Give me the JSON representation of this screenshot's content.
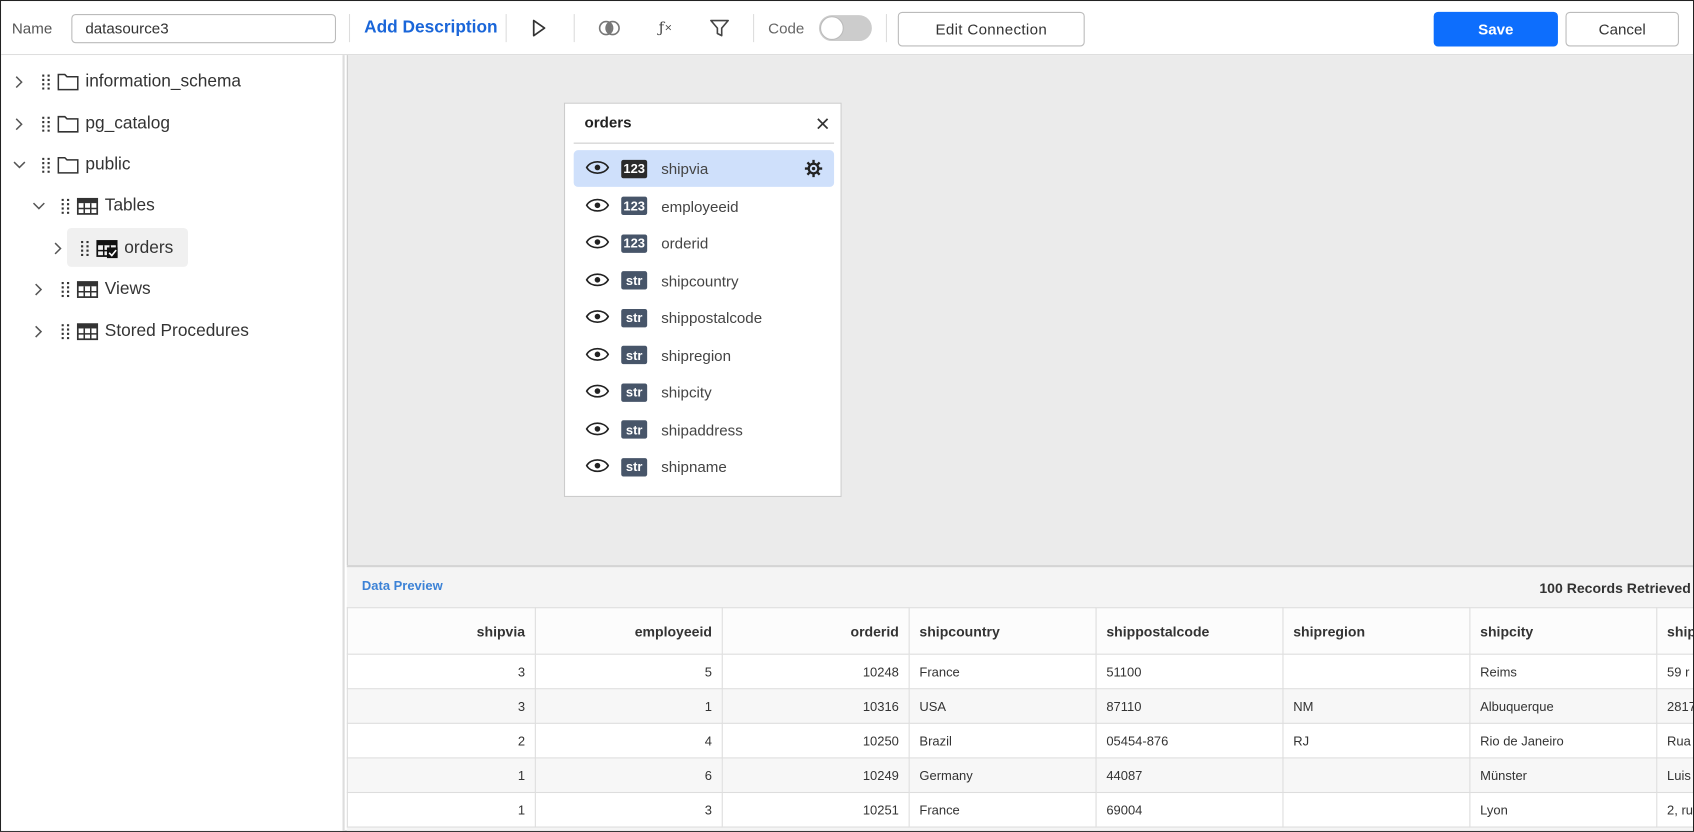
{
  "toolbar": {
    "name_label": "Name",
    "name_value": "datasource3",
    "add_description": "Add Description",
    "code_label": "Code",
    "code_toggle_on": false,
    "edit_connection": "Edit Connection",
    "save": "Save",
    "cancel": "Cancel",
    "accent_color": "#0d6efd",
    "icons": [
      "play-icon",
      "join-icon",
      "formula-icon",
      "filter-icon"
    ]
  },
  "tree": [
    {
      "label": "information_schema",
      "expanded": false,
      "icon": "folder-icon"
    },
    {
      "label": "pg_catalog",
      "expanded": false,
      "icon": "folder-icon"
    },
    {
      "label": "public",
      "expanded": true,
      "icon": "folder-icon"
    },
    {
      "label": "Tables",
      "expanded": true,
      "icon": "table-icon"
    },
    {
      "label": "orders",
      "expanded": false,
      "icon": "table-check-icon",
      "selected": true
    },
    {
      "label": "Views",
      "expanded": false,
      "icon": "table-icon"
    },
    {
      "label": "Stored Procedures",
      "expanded": false,
      "icon": "table-icon"
    }
  ],
  "card": {
    "title": "orders",
    "fields": [
      {
        "name": "shipvia",
        "type": "123",
        "active": true
      },
      {
        "name": "employeeid",
        "type": "123"
      },
      {
        "name": "orderid",
        "type": "123"
      },
      {
        "name": "shipcountry",
        "type": "str"
      },
      {
        "name": "shippostalcode",
        "type": "str"
      },
      {
        "name": "shipregion",
        "type": "str"
      },
      {
        "name": "shipcity",
        "type": "str"
      },
      {
        "name": "shipaddress",
        "type": "str"
      },
      {
        "name": "shipname",
        "type": "str"
      }
    ]
  },
  "preview": {
    "title": "Data Preview",
    "count": "100 Records Retrieved",
    "columns": [
      "shipvia",
      "employeeid",
      "orderid",
      "shipcountry",
      "shippostalcode",
      "shipregion",
      "shipcity",
      "ship"
    ],
    "rows": [
      [
        "3",
        "5",
        "10248",
        "France",
        "51100",
        "",
        "Reims",
        "59 r"
      ],
      [
        "3",
        "1",
        "10316",
        "USA",
        "87110",
        "NM",
        "Albuquerque",
        "2817"
      ],
      [
        "2",
        "4",
        "10250",
        "Brazil",
        "05454-876",
        "RJ",
        "Rio de Janeiro",
        "Rua"
      ],
      [
        "1",
        "6",
        "10249",
        "Germany",
        "44087",
        "",
        "Münster",
        "Luis"
      ],
      [
        "1",
        "3",
        "10251",
        "France",
        "69004",
        "",
        "Lyon",
        "2, ru"
      ]
    ]
  }
}
